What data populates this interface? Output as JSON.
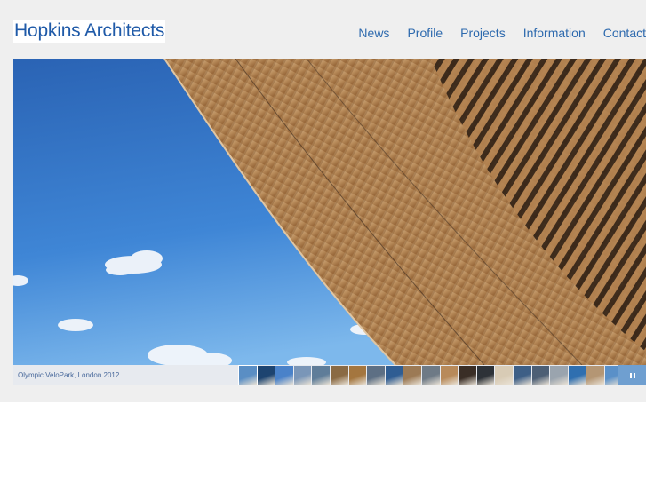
{
  "header": {
    "logo": "Hopkins Architects"
  },
  "nav": {
    "items": [
      {
        "label": "News"
      },
      {
        "label": "Profile"
      },
      {
        "label": "Projects"
      },
      {
        "label": "Information"
      },
      {
        "label": "Contact"
      }
    ]
  },
  "slideshow": {
    "caption": "Olympic VeloPark, London 2012",
    "thumbnail_count": 21,
    "thumbnail_colors": [
      "#5a8ec4",
      "#1d4470",
      "#4a82c9",
      "#7a96b8",
      "#5f7d99",
      "#8a6a44",
      "#a4763f",
      "#5d6f84",
      "#2f5d93",
      "#9c7a55",
      "#6e7a86",
      "#b88a5a",
      "#3a2e26",
      "#2d3238",
      "#d8cbb5",
      "#3e5f86",
      "#4d5f75",
      "#9aa4ae",
      "#2f6fb0",
      "#b49674",
      "#5a90c8"
    ]
  },
  "colors": {
    "brand": "#1f5aa8",
    "nav": "#2e6aae",
    "pause_button": "#6f9fd0"
  }
}
